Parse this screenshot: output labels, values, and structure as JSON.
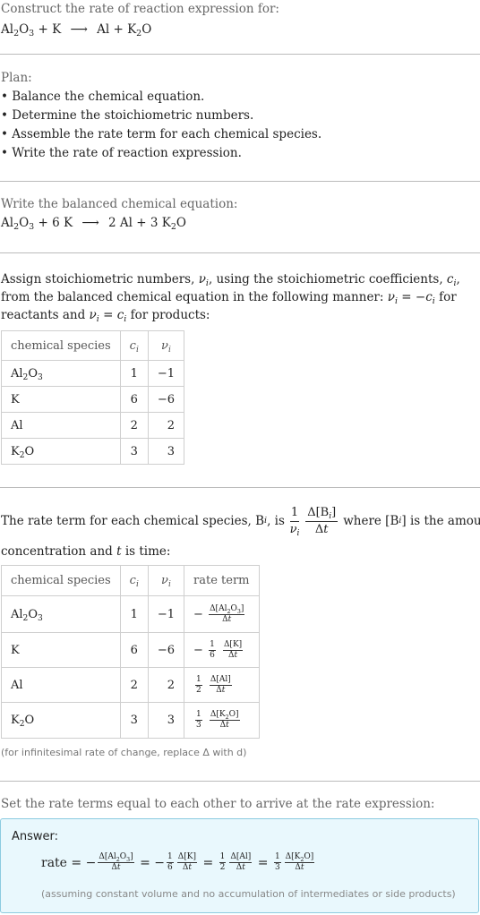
{
  "intro": {
    "label": "Construct the rate of reaction expression for:",
    "reaction": {
      "reactants": [
        "Al₂O₃",
        "K"
      ],
      "products": [
        "Al",
        "K₂O"
      ]
    }
  },
  "plan": {
    "label": "Plan:",
    "steps": [
      "Balance the chemical equation.",
      "Determine the stoichiometric numbers.",
      "Assemble the rate term for each chemical species.",
      "Write the rate of reaction expression."
    ]
  },
  "balanced": {
    "label": "Write the balanced chemical equation:",
    "equation": "Al₂O₃ + 6 K ⟶ 2 Al + 3 K₂O"
  },
  "stoich": {
    "text_1": "Assign stoichiometric numbers, ",
    "text_2": ", using the stoichiometric coefficients, ",
    "text_3": ", from the balanced chemical equation in the following manner: ",
    "text_4": " for reactants and ",
    "text_5": " for products:",
    "headers": [
      "chemical species",
      "c_i",
      "ν_i"
    ],
    "rows": [
      {
        "species": "Al2O3",
        "c": "1",
        "v": "−1"
      },
      {
        "species": "K",
        "c": "6",
        "v": "−6"
      },
      {
        "species": "Al",
        "c": "2",
        "v": "2"
      },
      {
        "species": "K2O",
        "c": "3",
        "v": "3"
      }
    ]
  },
  "rateterm": {
    "text_1": "The rate term for each chemical species, B",
    "text_2": ", is",
    "text_3": "where [B",
    "text_4": "] is the amount concentration and ",
    "text_5": " is time:",
    "headers": [
      "chemical species",
      "c_i",
      "ν_i",
      "rate term"
    ],
    "rows": [
      {
        "species": "Al2O3",
        "c": "1",
        "v": "−1",
        "sign": "−",
        "coef": "",
        "delta": "Δ[Al₂O₃]"
      },
      {
        "species": "K",
        "c": "6",
        "v": "−6",
        "sign": "−",
        "coef": "1/6",
        "delta": "Δ[K]"
      },
      {
        "species": "Al",
        "c": "2",
        "v": "2",
        "sign": "",
        "coef": "1/2",
        "delta": "Δ[Al]"
      },
      {
        "species": "K2O",
        "c": "3",
        "v": "3",
        "sign": "",
        "coef": "1/3",
        "delta": "Δ[K₂O]"
      }
    ],
    "note": "(for infinitesimal rate of change, replace Δ with d)"
  },
  "final": {
    "label": "Set the rate terms equal to each other to arrive at the rate expression:",
    "answer_label": "Answer:",
    "rate_word": "rate",
    "note": "(assuming constant volume and no accumulation of intermediates or side products)"
  },
  "colors": {
    "answer_bg": "#e9f8fd",
    "answer_border": "#8ccbe0",
    "divider": "#bbbbbb"
  }
}
